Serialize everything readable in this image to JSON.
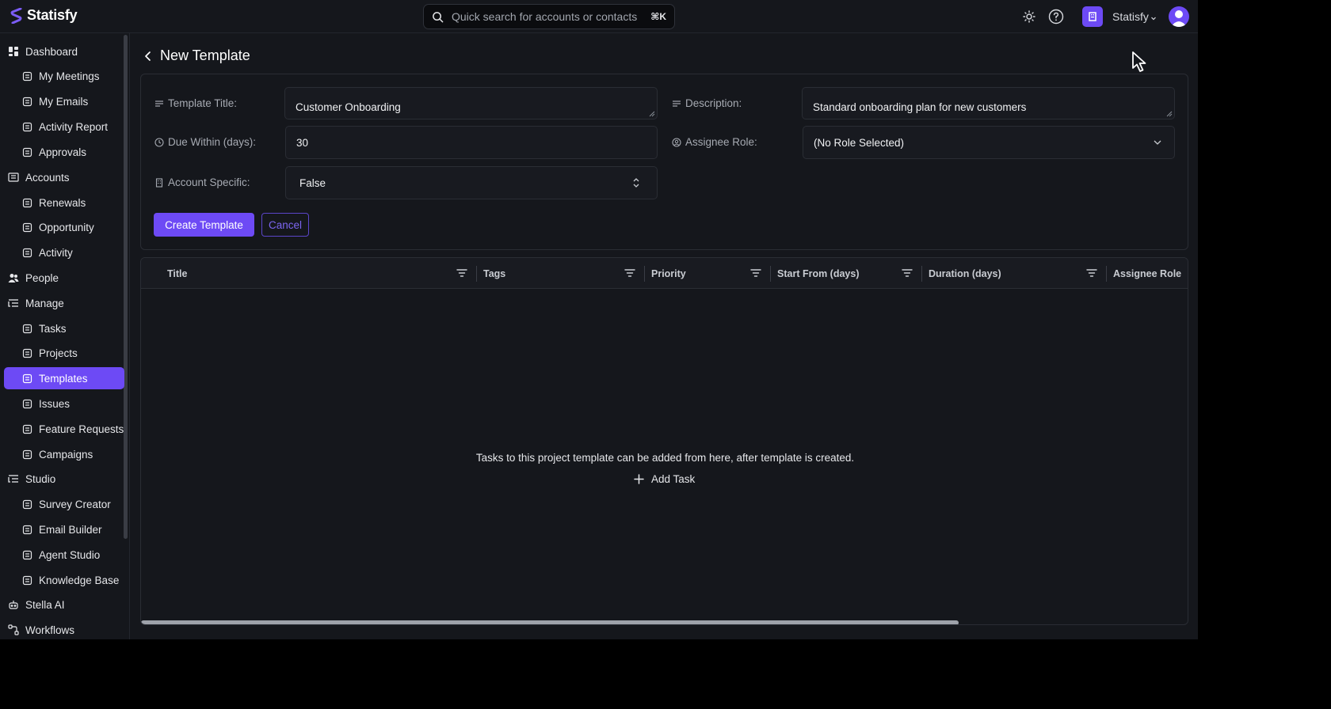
{
  "app": {
    "name": "Statisfy"
  },
  "search": {
    "placeholder": "Quick search for accounts or contacts",
    "shortcut": "⌘K"
  },
  "header": {
    "workspace": "Statisfy",
    "icons": [
      "sun-icon",
      "help-icon",
      "workspace-icon",
      "user-avatar"
    ]
  },
  "sidebar": {
    "items": [
      {
        "label": "Dashboard",
        "icon": "dashboard-icon",
        "level": "top"
      },
      {
        "label": "My Meetings",
        "icon": "calendar-icon",
        "level": "sub"
      },
      {
        "label": "My Emails",
        "icon": "mail-icon",
        "level": "sub"
      },
      {
        "label": "Activity Report",
        "icon": "clipboard-icon",
        "level": "sub"
      },
      {
        "label": "Approvals",
        "icon": "check-circle-icon",
        "level": "sub"
      },
      {
        "label": "Accounts",
        "icon": "accounts-icon",
        "level": "top"
      },
      {
        "label": "Renewals",
        "icon": "refresh-icon",
        "level": "sub"
      },
      {
        "label": "Opportunity",
        "icon": "trending-icon",
        "level": "sub"
      },
      {
        "label": "Activity",
        "icon": "clipboard-icon",
        "level": "sub"
      },
      {
        "label": "People",
        "icon": "people-icon",
        "level": "top"
      },
      {
        "label": "Manage",
        "icon": "manage-icon",
        "level": "top"
      },
      {
        "label": "Tasks",
        "icon": "list-icon",
        "level": "sub"
      },
      {
        "label": "Projects",
        "icon": "projects-icon",
        "level": "sub"
      },
      {
        "label": "Templates",
        "icon": "document-icon",
        "level": "sub",
        "active": true
      },
      {
        "label": "Issues",
        "icon": "alert-icon",
        "level": "sub"
      },
      {
        "label": "Feature Requests",
        "icon": "feature-icon",
        "level": "sub"
      },
      {
        "label": "Campaigns",
        "icon": "mail-icon",
        "level": "sub"
      },
      {
        "label": "Studio",
        "icon": "studio-icon",
        "level": "top"
      },
      {
        "label": "Survey Creator",
        "icon": "survey-icon",
        "level": "sub"
      },
      {
        "label": "Email Builder",
        "icon": "mail-icon",
        "level": "sub"
      },
      {
        "label": "Agent Studio",
        "icon": "chat-icon",
        "level": "sub"
      },
      {
        "label": "Knowledge Base",
        "icon": "database-icon",
        "level": "sub"
      },
      {
        "label": "Stella AI",
        "icon": "bot-icon",
        "level": "top"
      },
      {
        "label": "Workflows",
        "icon": "workflow-icon",
        "level": "top"
      }
    ]
  },
  "page": {
    "title": "New Template"
  },
  "form": {
    "template_title_label": "Template Title:",
    "template_title_value": "Customer Onboarding",
    "description_label": "Description:",
    "description_value": "Standard onboarding plan for new customers",
    "due_label": "Due Within (days):",
    "due_value": "30",
    "assignee_label": "Assignee Role:",
    "assignee_value": "(No Role Selected)",
    "account_specific_label": "Account Specific:",
    "account_specific_value": "False",
    "create_button": "Create Template",
    "cancel_button": "Cancel"
  },
  "grid": {
    "columns": [
      "Title",
      "Tags",
      "Priority",
      "Start From (days)",
      "Duration (days)",
      "Assignee Role"
    ],
    "empty_message": "Tasks to this project template can be added from here, after template is created.",
    "add_task": "Add Task"
  },
  "colors": {
    "accent": "#6d4af5",
    "background": "#15171c",
    "border": "#2a2d34"
  }
}
